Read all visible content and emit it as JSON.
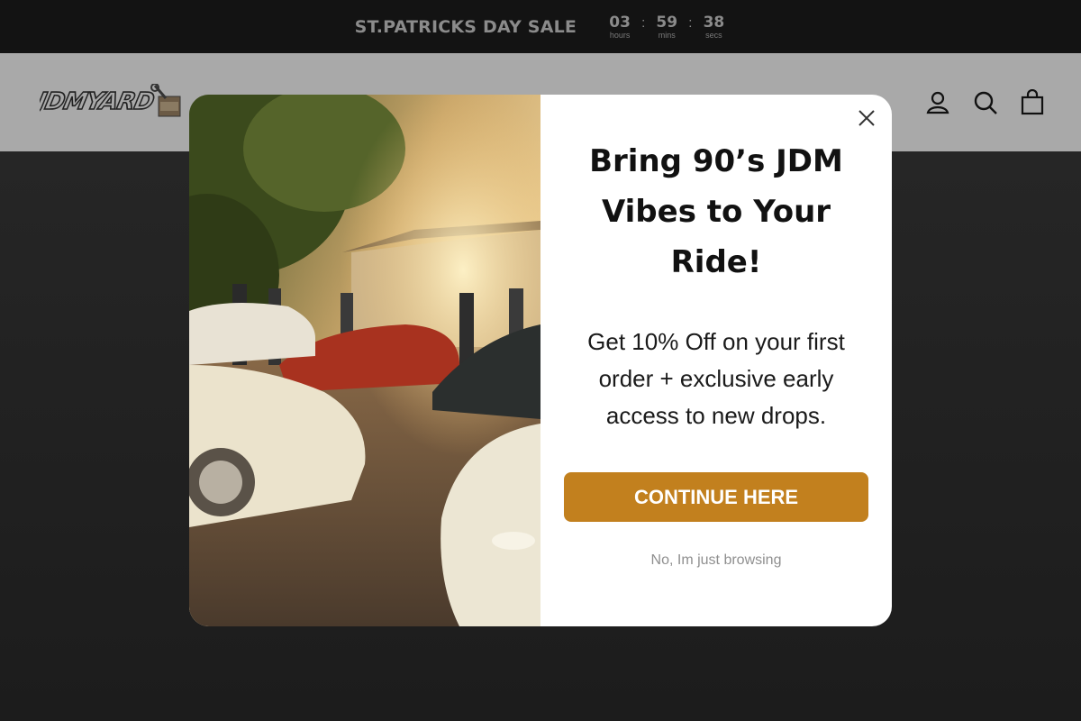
{
  "announcement": {
    "sale_text": "ST.PATRICKS DAY SALE",
    "countdown": [
      {
        "value": "03",
        "label": "hours"
      },
      {
        "value": "59",
        "label": "mins"
      },
      {
        "value": "38",
        "label": "secs"
      }
    ],
    "separator": ":"
  },
  "header": {
    "logo_text": "JDMYARD",
    "icons": [
      "account-icon",
      "search-icon",
      "cart-icon"
    ]
  },
  "popup": {
    "headline": "Bring 90’s JDM Vibes to Your Ride!",
    "subtext": "Get 10% Off on your first order + exclusive early access to new drops.",
    "cta_label": "CONTINUE HERE",
    "decline_label": "No, Im just browsing",
    "close_icon": "close-icon",
    "photo_icon": "photo-jdm-cars"
  },
  "colors": {
    "announce_bg": "#131313",
    "header_bg": "#a9a9a9",
    "cta_bg": "#c2801e",
    "cta_text": "#ffffff"
  }
}
